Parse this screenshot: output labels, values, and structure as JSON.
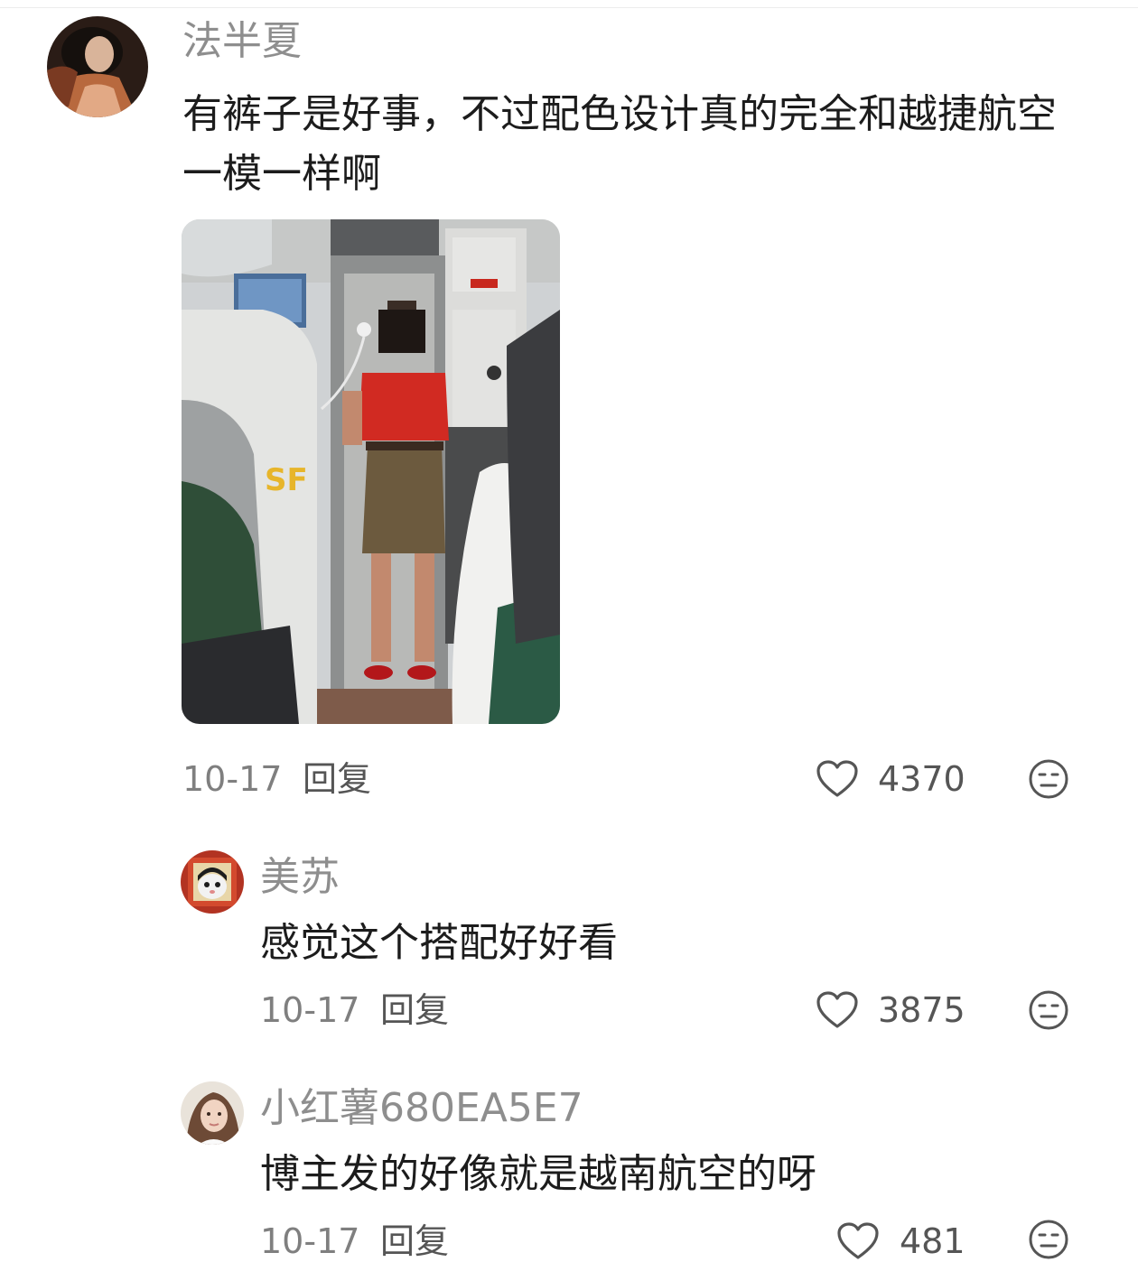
{
  "colors": {
    "name": "#8e8e8e",
    "text": "#1c1c1c",
    "meta": "#7f7f7f",
    "icon": "#555555"
  },
  "comments": [
    {
      "user": "法半夏",
      "text": "有裤子是好事，不过配色设计真的完全和越捷航空一模一样啊",
      "date": "10-17",
      "reply_label": "回复",
      "likes": "4370",
      "has_photo": true,
      "icons": {
        "like": "heart-outline-icon",
        "react": "neutral-face-icon"
      }
    },
    {
      "user": "美苏",
      "text": "感觉这个搭配好好看",
      "date": "10-17",
      "reply_label": "回复",
      "likes": "3875",
      "icons": {
        "like": "heart-outline-icon",
        "react": "neutral-face-icon"
      }
    },
    {
      "user": "小红薯680EA5E7",
      "text": "博主发的好像就是越南航空的呀",
      "date": "10-17",
      "reply_label": "回复",
      "likes": "481",
      "icons": {
        "like": "heart-outline-icon",
        "react": "neutral-face-icon"
      }
    }
  ]
}
